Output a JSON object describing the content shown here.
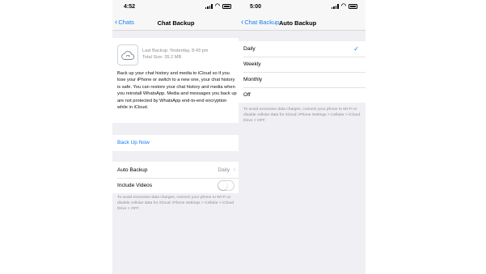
{
  "left_screen": {
    "status": {
      "time": "4:52"
    },
    "nav": {
      "back_label": "Chats",
      "title": "Chat Backup"
    },
    "backup_info": {
      "last_backup": "Last Backup: Yesterday, 8:43 pm",
      "total_size": "Total Size: 35.2 MB",
      "description": "Back up your chat history and media to iCloud so if you lose your iPhone or switch to a new one, your chat history is safe. You can restore your chat history and media when you reinstall WhatsApp. Media and messages you back up are not protected by WhatsApp end-to-end encryption while in iCloud."
    },
    "back_up_now_label": "Back Up Now",
    "settings": {
      "auto_backup_label": "Auto Backup",
      "auto_backup_value": "Daily",
      "include_videos_label": "Include Videos",
      "include_videos_on": false
    },
    "footnote": "To avoid excessive data charges, connect your phone to Wi-Fi or disable cellular data for iCloud: iPhone Settings > Cellular > iCloud Drive > OFF."
  },
  "right_screen": {
    "status": {
      "time": "5:00"
    },
    "nav": {
      "back_label": "Chat Backup",
      "title": "Auto Backup"
    },
    "options": [
      {
        "label": "Daily",
        "selected": true
      },
      {
        "label": "Weekly",
        "selected": false
      },
      {
        "label": "Monthly",
        "selected": false
      },
      {
        "label": "Off",
        "selected": false
      }
    ],
    "footnote": "To avoid excessive data charges, connect your phone to Wi-Fi or disable cellular data for iCloud: iPhone Settings > Cellular > iCloud Drive > OFF."
  },
  "colors": {
    "accent": "#1a7cf5",
    "grouped_background": "#efeff4",
    "secondary_text": "#8e8e93"
  },
  "icons": [
    "cloud-sync-icon",
    "chevron-left-icon",
    "chevron-right-icon",
    "checkmark-icon",
    "signal-icon",
    "wifi-icon",
    "battery-icon"
  ]
}
